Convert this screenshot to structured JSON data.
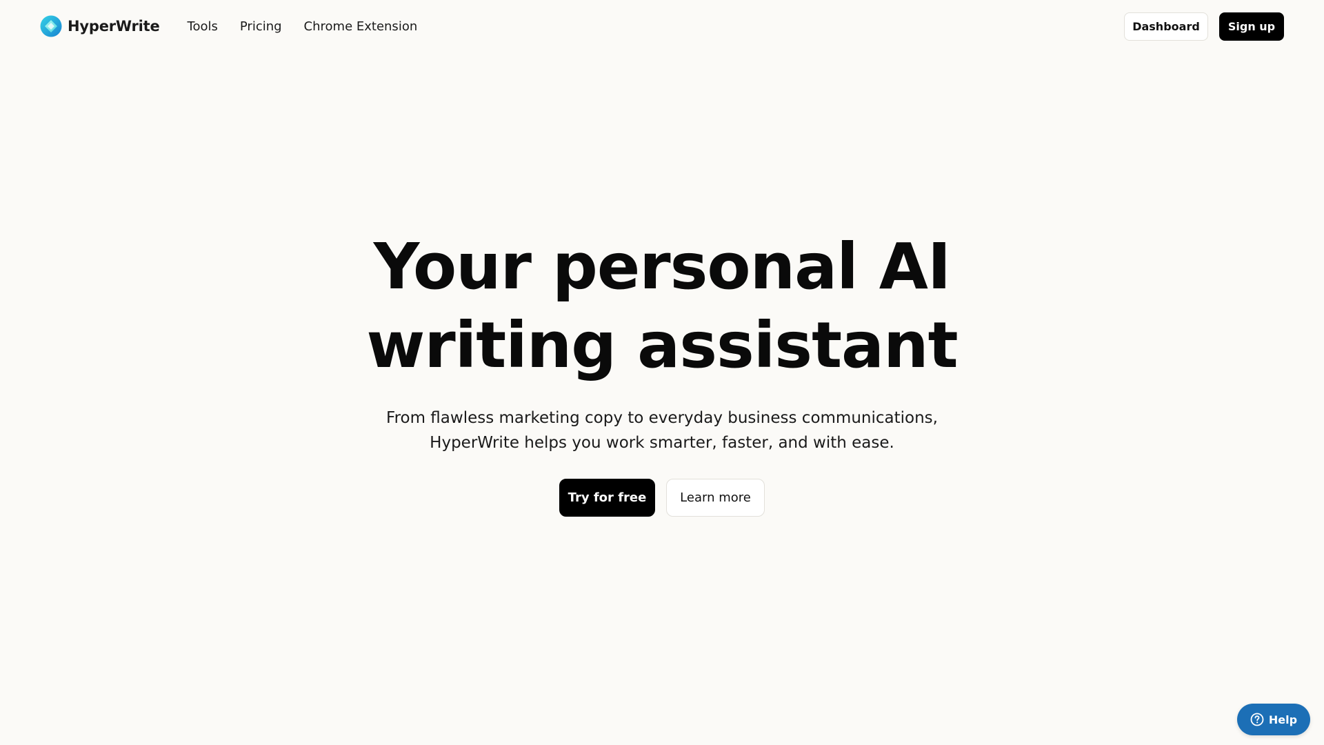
{
  "header": {
    "brand_name": "HyperWrite",
    "logo_icon": "hyperwrite-logo",
    "nav": [
      {
        "label": "Tools"
      },
      {
        "label": "Pricing"
      },
      {
        "label": "Chrome Extension"
      }
    ],
    "dashboard_label": "Dashboard",
    "signup_label": "Sign up"
  },
  "hero": {
    "title_line1": "Your personal AI",
    "title_line2": "writing assistant",
    "subtitle_line1": "From flawless marketing copy to everyday business communications,",
    "subtitle_line2": "HyperWrite helps you work smarter, faster, and with ease.",
    "primary_cta": "Try for free",
    "secondary_cta": "Learn more"
  },
  "help": {
    "label": "Help",
    "icon": "question-circle-icon"
  },
  "colors": {
    "background": "#FBFAF7",
    "primary_button": "#000000",
    "help_button": "#1C6FB6",
    "logo_gradient_start": "#2EC9E8",
    "logo_gradient_end": "#1A8FD6"
  }
}
